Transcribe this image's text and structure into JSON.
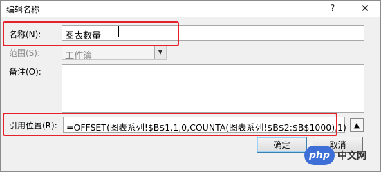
{
  "window": {
    "title": "编辑名称",
    "help_glyph": "?",
    "close_glyph": "✕"
  },
  "fields": {
    "name": {
      "label": "名称(N):",
      "value": "图表数量"
    },
    "scope": {
      "label": "范围(S):",
      "value": "工作簿"
    },
    "comment": {
      "label": "备注(O):",
      "value": ""
    },
    "refers_to": {
      "label": "引用位置(R):",
      "value": "=OFFSET(图表系列!$B$1,1,0,COUNTA(图表系列!$B$2:$B$1000),1)"
    }
  },
  "buttons": {
    "ok": "确定",
    "cancel": "取消"
  },
  "watermark": {
    "text": "中文网",
    "logo": "php"
  },
  "colors": {
    "highlight": "#e5212c",
    "dialog_bg": "#f0f0f0"
  }
}
